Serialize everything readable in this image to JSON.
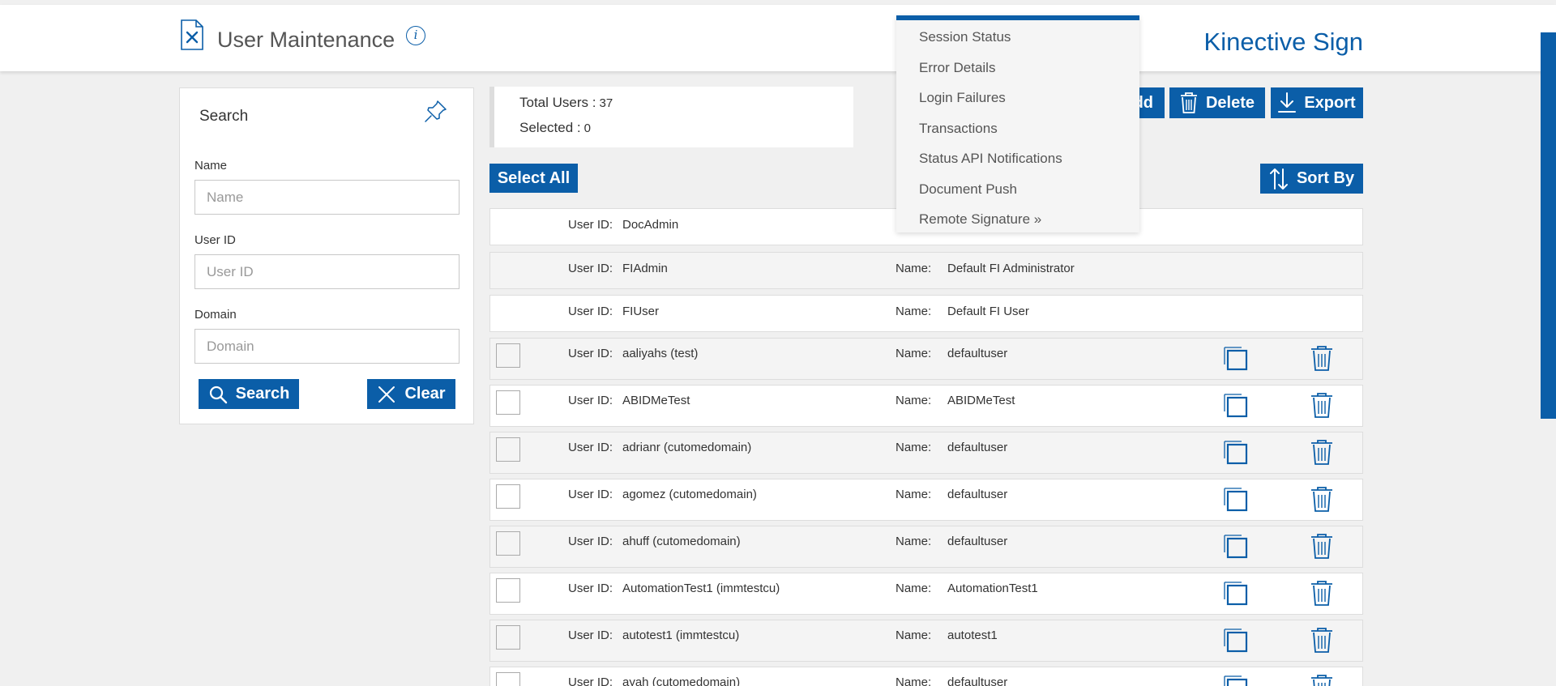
{
  "header": {
    "title": "User Maintenance",
    "info_icon": "i",
    "brand": "Kinective Sign"
  },
  "colors": {
    "accent": "#0b5ea8",
    "panel": "#ffffff",
    "background": "#f0f0f0"
  },
  "search": {
    "title": "Search",
    "name_label": "Name",
    "name_placeholder": "Name",
    "name_value": "",
    "userid_label": "User ID",
    "userid_placeholder": "User ID",
    "userid_value": "",
    "domain_label": "Domain",
    "domain_placeholder": "Domain",
    "domain_value": "",
    "search_button": "Search",
    "clear_button": "Clear"
  },
  "summary": {
    "total_label": "Total Users :",
    "total_value": "37",
    "selected_label": "Selected :",
    "selected_value": "0"
  },
  "toolbar": {
    "add_partial": "dd",
    "delete_button": "Delete",
    "export_button": "Export",
    "select_all_button": "Select All",
    "sort_button": "Sort By"
  },
  "menu": {
    "items": [
      "Session Status",
      "Error Details",
      "Login Failures",
      "Transactions",
      "Status API Notifications",
      "Document Push",
      "Remote Signature »"
    ]
  },
  "users": {
    "userid_label": "User ID:",
    "name_label": "Name:",
    "rows": [
      {
        "user_id": "DocAdmin",
        "name": ""
      },
      {
        "user_id": "FIAdmin",
        "name": "Default FI Administrator"
      },
      {
        "user_id": "FIUser",
        "name": "Default FI User"
      },
      {
        "user_id": "aaliyahs (test)",
        "name": "defaultuser"
      },
      {
        "user_id": "ABIDMeTest",
        "name": "ABIDMeTest"
      },
      {
        "user_id": "adrianr (cutomedomain)",
        "name": "defaultuser"
      },
      {
        "user_id": "agomez (cutomedomain)",
        "name": "defaultuser"
      },
      {
        "user_id": "ahuff (cutomedomain)",
        "name": "defaultuser"
      },
      {
        "user_id": "AutomationTest1 (immtestcu)",
        "name": "AutomationTest1"
      },
      {
        "user_id": "autotest1 (immtestcu)",
        "name": "autotest1"
      },
      {
        "user_id": "ayah (cutomedomain)",
        "name": "defaultuser"
      }
    ]
  }
}
